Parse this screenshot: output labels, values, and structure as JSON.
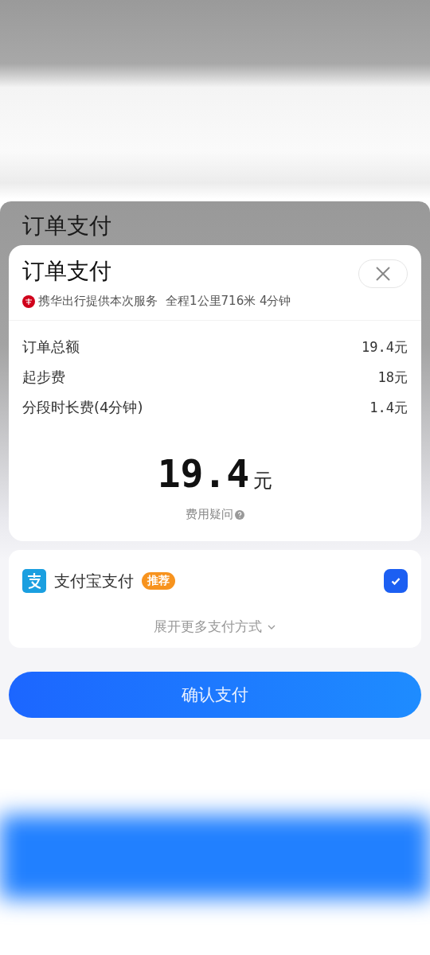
{
  "background_title": "订单支付",
  "dialog": {
    "title": "订单支付",
    "provider": "携华出行提供本次服务",
    "trip": "全程1公里716米  4分钟"
  },
  "fees": [
    {
      "label": "订单总额",
      "value": "19.4元"
    },
    {
      "label": "起步费",
      "value": "18元"
    },
    {
      "label": "分段时长费(4分钟)",
      "value": "1.4元"
    }
  ],
  "total": {
    "amount": "19.4",
    "unit": "元"
  },
  "fee_question": "费用疑问",
  "payment_methods": [
    {
      "name": "支付宝支付",
      "badge": "推荐",
      "selected": true
    }
  ],
  "more_methods": "展开更多支付方式",
  "confirm_button": "确认支付"
}
